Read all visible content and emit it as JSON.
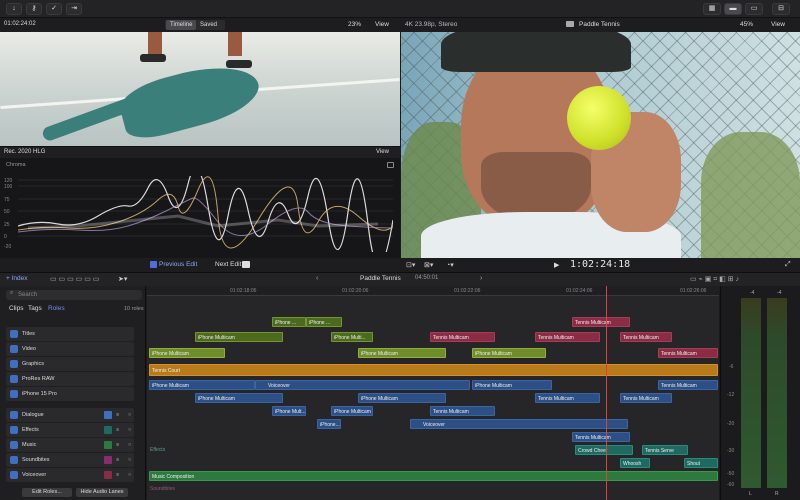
{
  "toolbar": {
    "timecode": "01:02:24:02",
    "mode_timeline": "Timeline",
    "mode_saved": "Saved",
    "left_zoom": "23%",
    "view": "View",
    "format": "4K 23.98p, Stereo",
    "project": "Paddle Tennis",
    "right_zoom": "45%"
  },
  "scope": {
    "colorspace": "Rec. 2020 HLG",
    "view": "View",
    "label": "Chroma",
    "ticks": [
      "120",
      "100",
      "75",
      "50",
      "25",
      "0",
      "-20"
    ]
  },
  "viewer": {
    "timecode": "1:02:24:18"
  },
  "mid": {
    "index": "Index",
    "prev": "Previous Edit",
    "next": "Next Edit",
    "project": "Paddle Tennis",
    "duration": "04:50:01"
  },
  "sidebar": {
    "search_placeholder": "Search",
    "tabs": [
      "Clips",
      "Tags",
      "Roles"
    ],
    "count": "10 roles",
    "roles_top": [
      "Titles",
      "Video",
      "Graphics",
      "ProRes RAW",
      "iPhone 15 Pro"
    ],
    "roles_audio": [
      "Dialogue",
      "Effects",
      "Music",
      "Soundbites",
      "Voiceover"
    ],
    "edit_roles": "Edit Roles...",
    "hide_lanes": "Hide Audio Lanes"
  },
  "ruler": [
    "01:02:18:06",
    "01:02:20:06",
    "01:02:22:06",
    "01:02:24:06",
    "01:02:26:06"
  ],
  "clips": {
    "iphone": "iPhone ...",
    "iphone_mc": "iPhone Multicam",
    "iphone_mul": "iPhone Mult...",
    "iphone_mu": "iPhone...",
    "iphone_m": "iPhone Multi...",
    "tennis_mc": "Tennis Multicam",
    "tennis_court": "Tennis Court",
    "voiceover": "Voiceover",
    "crowd": "Crowd Cheer",
    "serve": "Tennis Serve",
    "whoosh": "Whoosh",
    "shout": "Shout",
    "music": "Music Composition",
    "effects": "Effects",
    "soundbites": "Soundbites"
  },
  "meters": {
    "ticks": [
      "-6",
      "-12",
      "-20",
      "-30",
      "-50",
      "-60"
    ],
    "top": [
      "-4",
      "-4"
    ],
    "channels": [
      "L",
      "R"
    ]
  },
  "colors": {
    "green": "#6f8d2a",
    "pink": "#8a2d44",
    "blue": "#2c4f86",
    "teal": "#1e6a60",
    "orange": "#b87a1a",
    "music": "#2d7a3f",
    "accent": "#3f6fbf"
  }
}
